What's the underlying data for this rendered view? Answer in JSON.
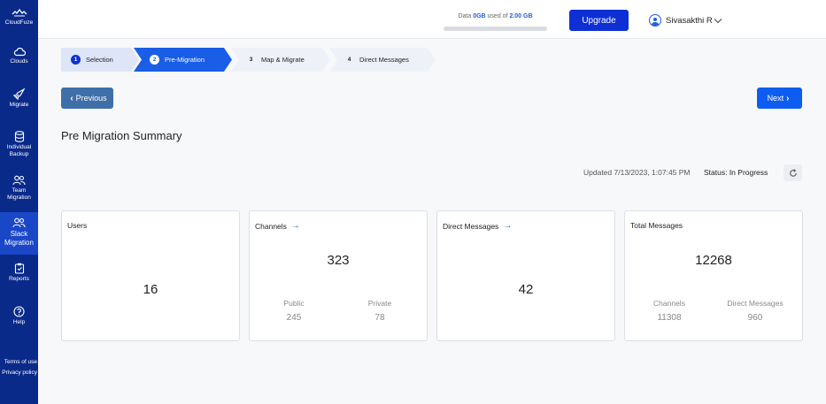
{
  "sidebar": {
    "items": [
      {
        "label": "CloudFuze",
        "icon": "cloudfuze-logo-icon"
      },
      {
        "label": "Clouds",
        "icon": "cloud-icon"
      },
      {
        "label": "Migrate",
        "icon": "rocket-icon"
      },
      {
        "label": "Individual Backup",
        "icon": "database-icon"
      },
      {
        "label": "Team Migration",
        "icon": "team-icon"
      },
      {
        "label": "Slack Migration",
        "icon": "team-icon"
      },
      {
        "label": "Reports",
        "icon": "report-icon"
      },
      {
        "label": "Help",
        "icon": "help-icon"
      }
    ],
    "footer": {
      "terms": "Terms of use",
      "privacy": "Privacy policy"
    }
  },
  "header": {
    "quota": {
      "prefix": "Data ",
      "used": "0GB",
      "middle": " used of ",
      "total": "2.00 GB",
      "used_fraction": 0
    },
    "upgrade_label": "Upgrade",
    "user_name": "Sivasakthi R"
  },
  "stepper": {
    "steps": [
      {
        "num": "1",
        "label": "Selection",
        "state": "done"
      },
      {
        "num": "2",
        "label": "Pre-Migration",
        "state": "active"
      },
      {
        "num": "3",
        "label": "Map & Migrate",
        "state": "todo"
      },
      {
        "num": "4",
        "label": "Direct Messages",
        "state": "todo"
      }
    ]
  },
  "nav": {
    "previous_label": "Previous",
    "next_label": "Next"
  },
  "summary": {
    "title": "Pre Migration Summary",
    "updated": "Updated 7/13/2023, 1:07:45 PM",
    "status": "Status: In Progress"
  },
  "cards": {
    "users": {
      "title": "Users",
      "value": "16"
    },
    "channels": {
      "title": "Channels",
      "value": "323",
      "public_label": "Public",
      "public_value": "245",
      "private_label": "Private",
      "private_value": "78"
    },
    "direct_messages": {
      "title": "Direct Messages",
      "value": "42"
    },
    "total_messages": {
      "title": "Total Messages",
      "value": "12268",
      "channels_label": "Channels",
      "channels_value": "11308",
      "dm_label": "Direct Messages",
      "dm_value": "960"
    }
  },
  "colors": {
    "sidebar": "#0a2a8a",
    "accent": "#1a5ee8",
    "upgrade": "#0d2fd4",
    "previous": "#3f6fa8"
  }
}
